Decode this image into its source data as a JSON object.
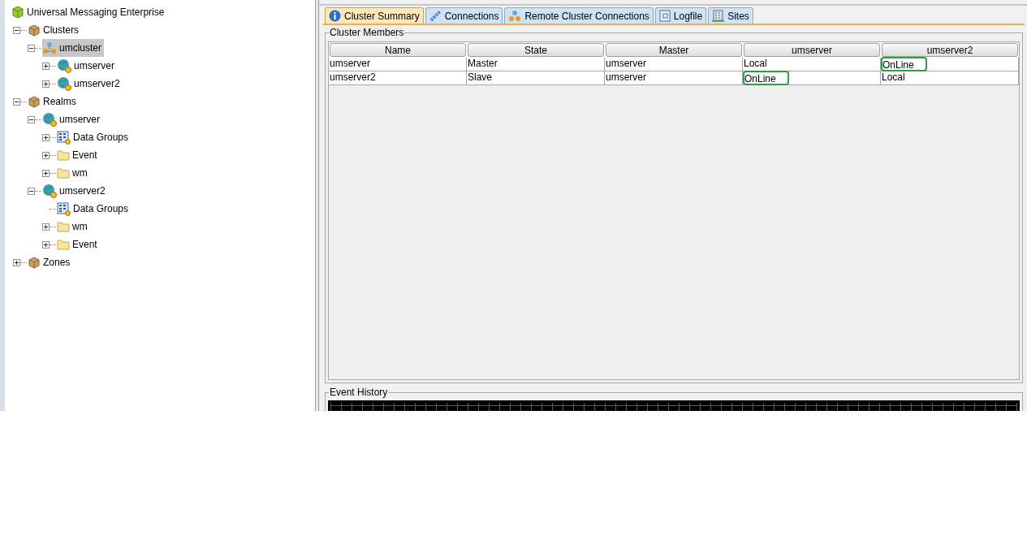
{
  "tree": {
    "label": "Universal Messaging Enterprise",
    "kind": "enterprise",
    "children": [
      {
        "label": "Clusters",
        "kind": "box",
        "expanded": true,
        "selected": false,
        "children": [
          {
            "label": "umcluster",
            "kind": "cluster",
            "expanded": true,
            "selected": true,
            "children": [
              {
                "label": "umserver",
                "kind": "server",
                "expanded": false,
                "selected": false
              },
              {
                "label": "umserver2",
                "kind": "server",
                "expanded": false,
                "selected": false
              }
            ]
          }
        ]
      },
      {
        "label": "Realms",
        "kind": "box",
        "expanded": true,
        "selected": false,
        "children": [
          {
            "label": "umserver",
            "kind": "server",
            "expanded": true,
            "selected": false,
            "children": [
              {
                "label": "Data Groups",
                "kind": "datagroups",
                "expanded": false,
                "selected": false
              },
              {
                "label": "Event",
                "kind": "folder",
                "expanded": false,
                "selected": false
              },
              {
                "label": "wm",
                "kind": "folder",
                "expanded": false,
                "selected": false
              }
            ]
          },
          {
            "label": "umserver2",
            "kind": "server",
            "expanded": true,
            "selected": false,
            "children": [
              {
                "label": "Data Groups",
                "kind": "datagroups",
                "selected": false
              },
              {
                "label": "wm",
                "kind": "folder",
                "expanded": false,
                "selected": false
              },
              {
                "label": "Event",
                "kind": "folder",
                "expanded": false,
                "selected": false
              }
            ]
          }
        ]
      },
      {
        "label": "Zones",
        "kind": "box",
        "expanded": false,
        "selected": false
      }
    ]
  },
  "tabs": [
    {
      "label": "Cluster Summary",
      "kind": "info",
      "selected": true
    },
    {
      "label": "Connections",
      "kind": "link",
      "selected": false
    },
    {
      "label": "Remote Cluster Connections",
      "kind": "cluster",
      "selected": false
    },
    {
      "label": "Logfile",
      "kind": "log",
      "selected": false
    },
    {
      "label": "Sites",
      "kind": "sites",
      "selected": false
    }
  ],
  "cluster_members": {
    "title": "Cluster Members",
    "columns": [
      "Name",
      "State",
      "Master",
      "umserver",
      "umserver2"
    ],
    "rows": [
      [
        {
          "text": "umserver",
          "highlighted": false
        },
        {
          "text": "Master",
          "highlighted": false
        },
        {
          "text": "umserver",
          "highlighted": false
        },
        {
          "text": "Local",
          "highlighted": false
        },
        {
          "text": "OnLine",
          "highlighted": true
        }
      ],
      [
        {
          "text": "umserver2",
          "highlighted": false
        },
        {
          "text": "Slave",
          "highlighted": false
        },
        {
          "text": "umserver",
          "highlighted": false
        },
        {
          "text": "OnLine",
          "highlighted": true
        },
        {
          "text": "Local",
          "highlighted": false
        }
      ]
    ]
  },
  "event_history": {
    "title": "Event History"
  }
}
